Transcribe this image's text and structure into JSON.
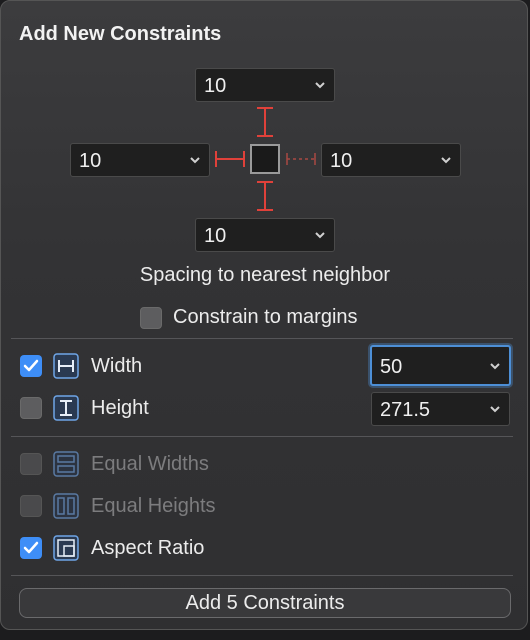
{
  "title": "Add New Constraints",
  "spacing": {
    "top": "10",
    "left": "10",
    "right": "10",
    "bottom": "10",
    "caption": "Spacing to nearest neighbor"
  },
  "constrain_margins": {
    "label": "Constrain to margins",
    "checked": false
  },
  "rows": {
    "width": {
      "label": "Width",
      "value": "50",
      "checked": true
    },
    "height": {
      "label": "Height",
      "value": "271.5",
      "checked": false
    },
    "equal_widths": {
      "label": "Equal Widths",
      "checked": false,
      "enabled": false
    },
    "equal_heights": {
      "label": "Equal Heights",
      "checked": false,
      "enabled": false
    },
    "aspect_ratio": {
      "label": "Aspect Ratio",
      "checked": true
    }
  },
  "add_button": "Add 5 Constraints",
  "colors": {
    "accent": "#3e8ef7",
    "strut_red": "#e0413a",
    "icon_blue": "#6fa6e8"
  }
}
